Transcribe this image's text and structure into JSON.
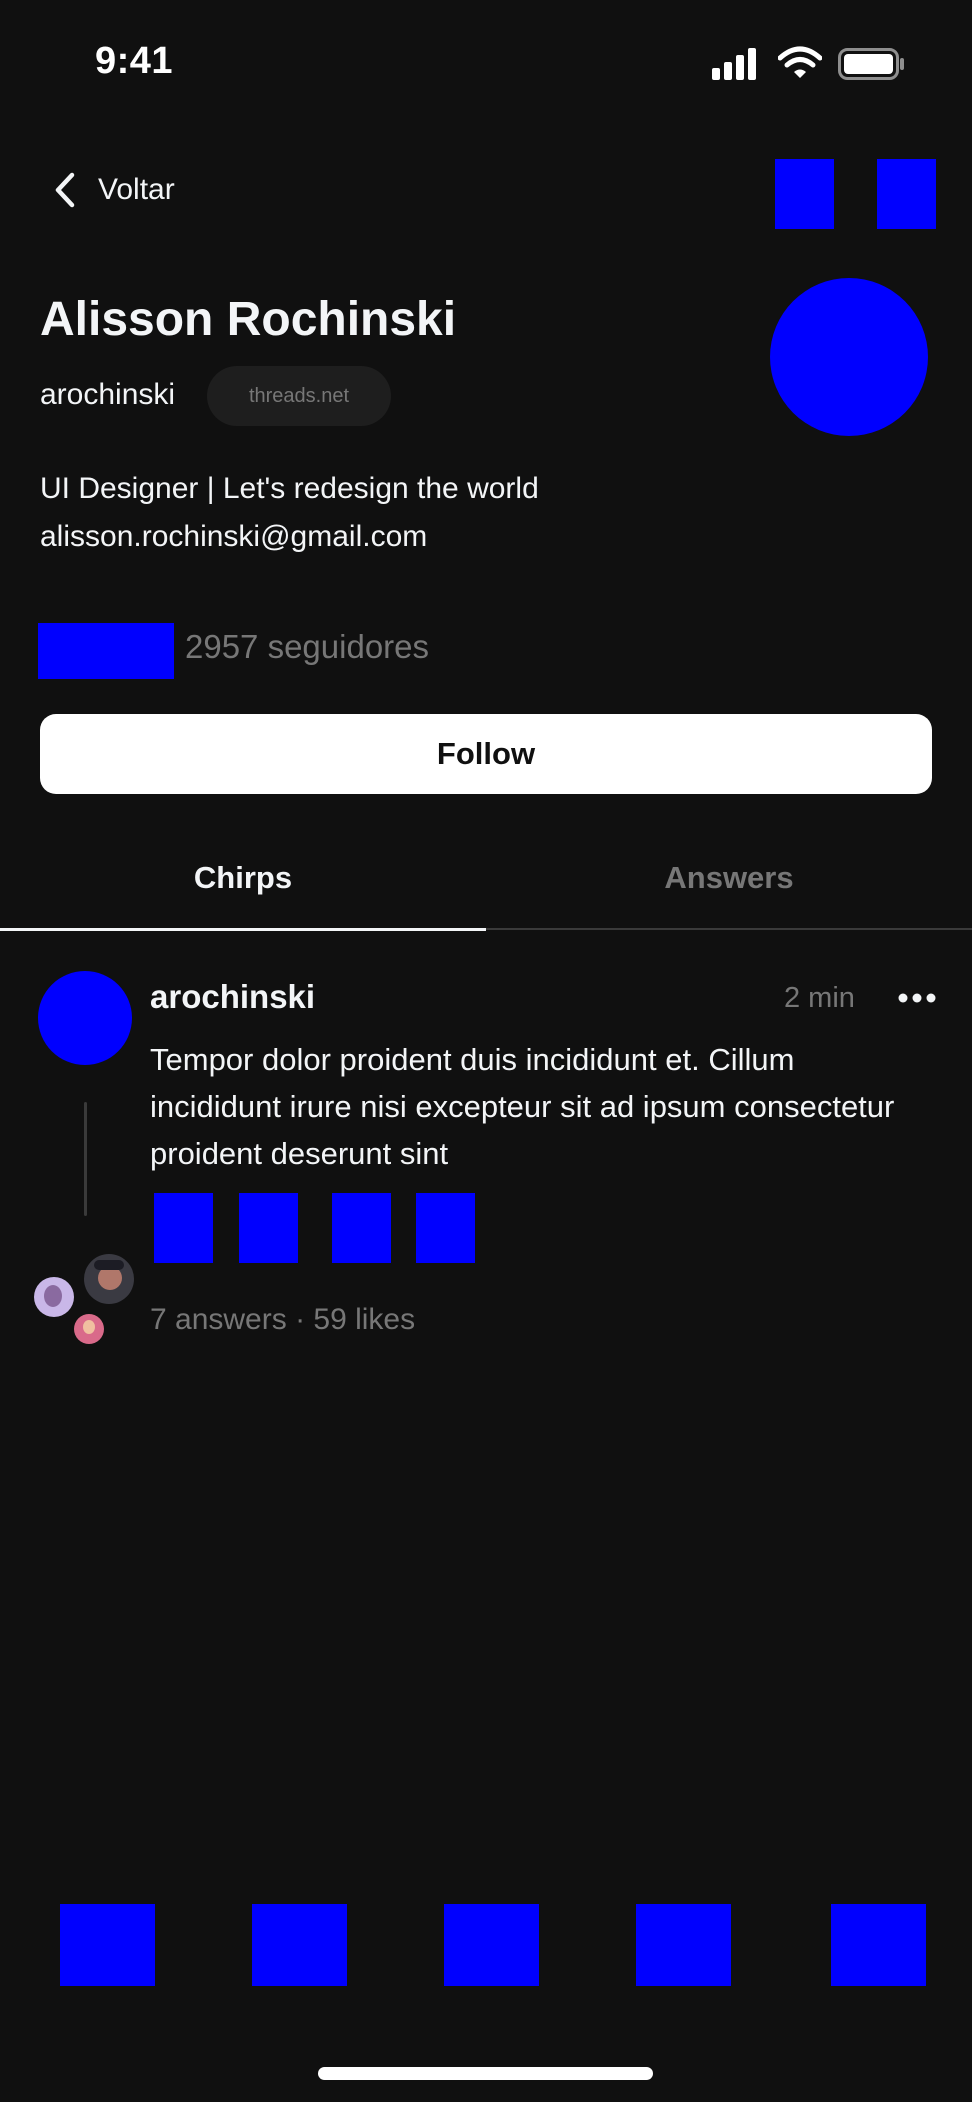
{
  "status_bar": {
    "time": "9:41"
  },
  "nav": {
    "back_label": "Voltar",
    "back_icon": "chevron-left-icon"
  },
  "profile": {
    "name": "Alisson Rochinski",
    "handle": "arochinski",
    "domain": "threads.net",
    "bio_line1": "UI Designer | Let's redesign the world",
    "bio_line2": "alisson.rochinski@gmail.com",
    "followers": "2957 seguidores",
    "follow_label": "Follow"
  },
  "tabs": [
    {
      "label": "Chirps",
      "active": true
    },
    {
      "label": "Answers",
      "active": false
    }
  ],
  "post": {
    "author": "arochinski",
    "time": "2 min",
    "text": "Tempor dolor proident duis incididunt et. Cillum incididunt irure nisi excepteur sit ad ipsum consectetur proident deserunt sint",
    "stats": "7 answers · 59 likes"
  },
  "colors": {
    "background": "#101010",
    "text": "#f3f5f7",
    "muted": "#777777",
    "placeholder": "#0000ff"
  }
}
